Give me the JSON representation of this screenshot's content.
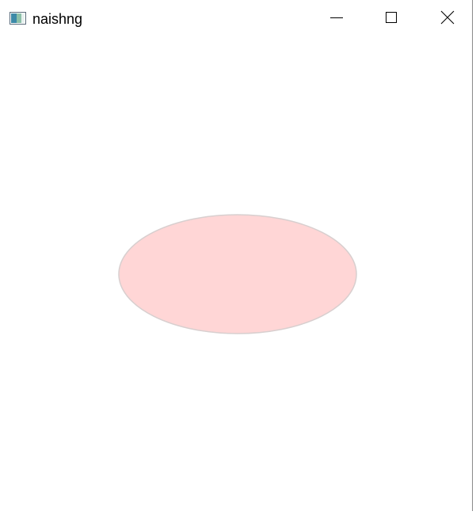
{
  "window": {
    "title": "naishng",
    "app_icon": "app-window-icon",
    "controls": {
      "minimize_icon": "minimize-icon",
      "maximize_icon": "maximize-icon",
      "close_icon": "close-icon"
    }
  },
  "canvas": {
    "shape": "ellipse",
    "fill_color": "#ffd6d6",
    "stroke_color": "#d8cfcf"
  }
}
